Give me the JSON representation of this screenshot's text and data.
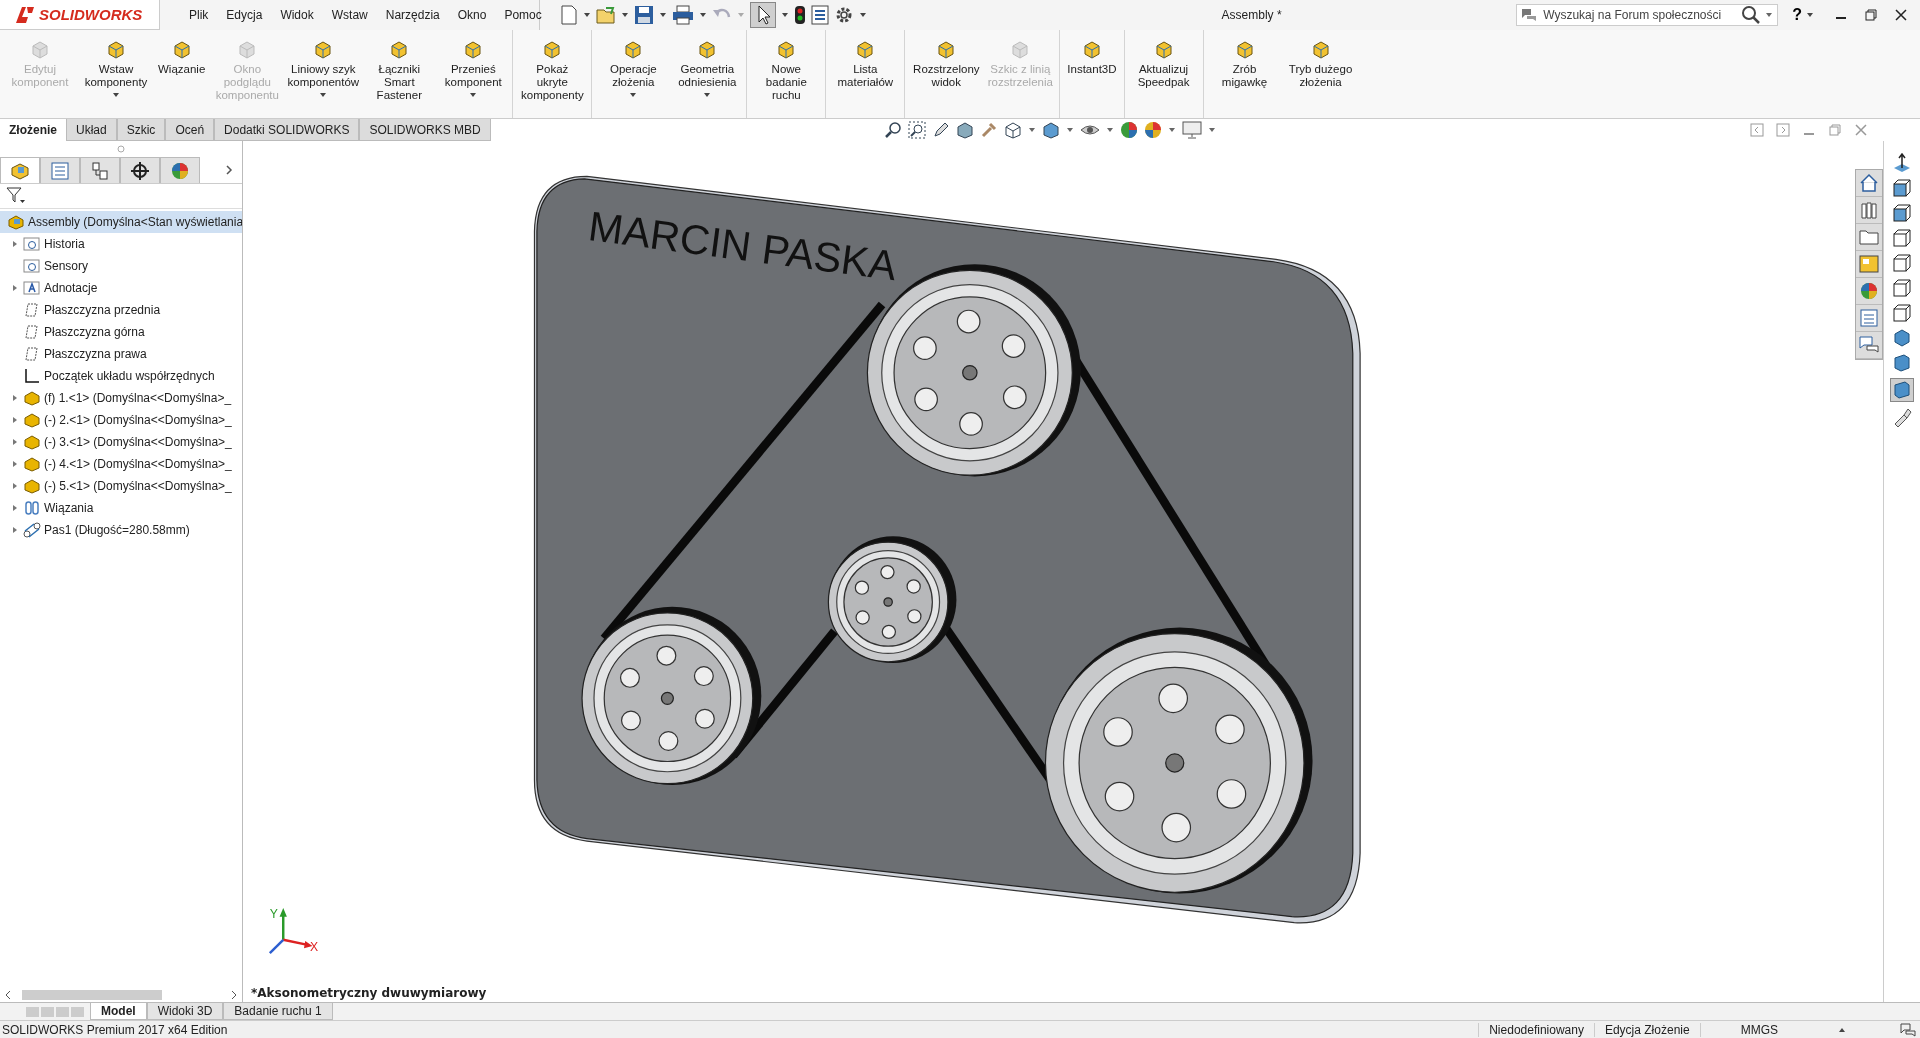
{
  "app": {
    "name": "SOLIDWORKS"
  },
  "menu": [
    "Plik",
    "Edycja",
    "Widok",
    "Wstaw",
    "Narzędzia",
    "Okno",
    "Pomoc"
  ],
  "window": {
    "title": "Assembly *"
  },
  "search": {
    "placeholder": "Wyszukaj na Forum społeczności"
  },
  "help_button": "?",
  "ribbon": [
    {
      "label": "Edytuj komponent",
      "disabled": true,
      "dropdown": false,
      "separator_after": false
    },
    {
      "label": "Wstaw komponenty",
      "disabled": false,
      "dropdown": true,
      "separator_after": false
    },
    {
      "label": "Wiązanie",
      "disabled": false,
      "dropdown": false,
      "separator_after": false
    },
    {
      "label": "Okno podglądu komponentu",
      "disabled": true,
      "dropdown": false,
      "separator_after": false
    },
    {
      "label": "Liniowy szyk komponentów",
      "disabled": false,
      "dropdown": true,
      "separator_after": false
    },
    {
      "label": "Łączniki Smart Fastener",
      "disabled": false,
      "dropdown": false,
      "separator_after": false
    },
    {
      "label": "Przenieś komponent",
      "disabled": false,
      "dropdown": true,
      "separator_after": true
    },
    {
      "label": "Pokaż ukryte komponenty",
      "disabled": false,
      "dropdown": false,
      "separator_after": true
    },
    {
      "label": "Operacje złożenia",
      "disabled": false,
      "dropdown": true,
      "separator_after": false
    },
    {
      "label": "Geometria odniesienia",
      "disabled": false,
      "dropdown": true,
      "separator_after": true
    },
    {
      "label": "Nowe badanie ruchu",
      "disabled": false,
      "dropdown": false,
      "separator_after": true
    },
    {
      "label": "Lista materiałów",
      "disabled": false,
      "dropdown": false,
      "separator_after": true
    },
    {
      "label": "Rozstrzelony widok",
      "disabled": false,
      "dropdown": false,
      "separator_after": false
    },
    {
      "label": "Szkic z linią rozstrzelenia",
      "disabled": true,
      "dropdown": false,
      "separator_after": true
    },
    {
      "label": "Instant3D",
      "disabled": false,
      "dropdown": false,
      "separator_after": true
    },
    {
      "label": "Aktualizuj Speedpak",
      "disabled": false,
      "dropdown": false,
      "separator_after": true
    },
    {
      "label": "Zrób migawkę",
      "disabled": false,
      "dropdown": false,
      "separator_after": false
    },
    {
      "label": "Tryb dużego złożenia",
      "disabled": false,
      "dropdown": false,
      "separator_after": false
    }
  ],
  "command_tabs": [
    {
      "label": "Złożenie",
      "selected": true
    },
    {
      "label": "Układ",
      "selected": false
    },
    {
      "label": "Szkic",
      "selected": false
    },
    {
      "label": "Oceń",
      "selected": false
    },
    {
      "label": "Dodatki SOLIDWORKS",
      "selected": false
    },
    {
      "label": "SOLIDWORKS MBD",
      "selected": false
    }
  ],
  "tree": [
    {
      "label": "Assembly  (Domyślna<Stan wyświetlania",
      "kind": "assembly",
      "selected": true,
      "children": [
        {
          "label": "Historia",
          "kind": "folder",
          "expanded": false,
          "selected": false
        },
        {
          "label": "Sensory",
          "kind": "folder",
          "selected": false
        },
        {
          "label": "Adnotacje",
          "kind": "annotation",
          "expanded": false,
          "selected": false
        },
        {
          "label": "Płaszczyzna przednia",
          "kind": "plane",
          "selected": false
        },
        {
          "label": "Płaszczyzna górna",
          "kind": "plane",
          "selected": false
        },
        {
          "label": "Płaszczyzna prawa",
          "kind": "plane",
          "selected": false
        },
        {
          "label": "Początek układu współrzędnych",
          "kind": "origin",
          "selected": false
        },
        {
          "label": "(f) 1.<1> (Domyślna<<Domyślna>_",
          "kind": "part",
          "expanded": false,
          "selected": false
        },
        {
          "label": "(-) 2.<1> (Domyślna<<Domyślna>_",
          "kind": "part",
          "expanded": false,
          "selected": false
        },
        {
          "label": "(-) 3.<1> (Domyślna<<Domyślna>_",
          "kind": "part",
          "expanded": false,
          "selected": false
        },
        {
          "label": "(-) 4.<1> (Domyślna<<Domyślna>_",
          "kind": "part",
          "expanded": false,
          "selected": false
        },
        {
          "label": "(-) 5.<1> (Domyślna<<Domyślna>_",
          "kind": "part",
          "expanded": false,
          "selected": false
        },
        {
          "label": "Wiązania",
          "kind": "mates",
          "expanded": false,
          "selected": false
        },
        {
          "label": "Pas1 (Długość=280.58mm)",
          "kind": "belt",
          "expanded": false,
          "selected": false
        }
      ]
    }
  ],
  "viewport": {
    "engraving": "MARCIN PASKA",
    "view_name": "*Aksonometryczny dwuwymiarowy",
    "triad": {
      "y_label": "Y",
      "x_label": "X"
    }
  },
  "bottom_tabs": [
    {
      "label": "Model",
      "selected": true
    },
    {
      "label": "Widoki 3D",
      "selected": false
    },
    {
      "label": "Badanie ruchu 1",
      "selected": false
    }
  ],
  "status_bar": {
    "product": "SOLIDWORKS Premium 2017 x64 Edition",
    "state": "Niedodefiniowany",
    "mode": "Edycja Złożenie",
    "units": "MMGS"
  }
}
